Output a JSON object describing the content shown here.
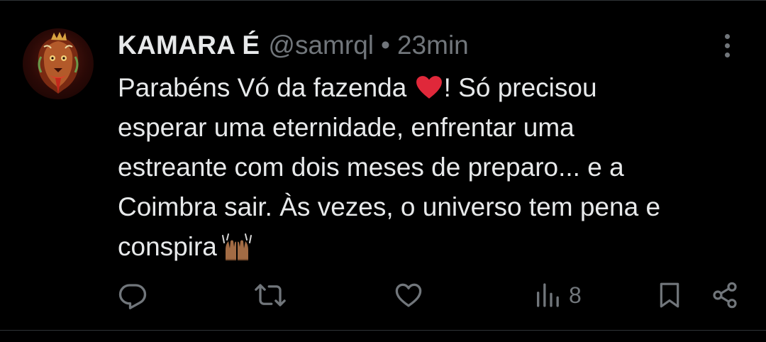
{
  "tweet": {
    "author_name": "KAMARA É",
    "handle": "@samrql",
    "separator": "•",
    "time": "23min",
    "text_lines": [
      "Parabéns Vó da fazenda",
      "! Só precisou",
      "esperar uma eternidade, enfrentar uma",
      "estreante com dois meses de preparo... e a",
      "Coimbra sair. Às vezes, o universo tem pena e",
      "conspira"
    ],
    "emojis": [
      "red-heart",
      "raising-hands"
    ],
    "views_count": "8"
  },
  "actions": {
    "reply_icon": "reply-icon",
    "retweet_icon": "retweet-icon",
    "like_icon": "like-icon",
    "views_icon": "views-icon",
    "bookmark_icon": "bookmark-icon",
    "share_icon": "share-icon"
  },
  "colors": {
    "background": "#000000",
    "text_primary": "#e7e9ea",
    "text_secondary": "#71767b",
    "divider": "#2f3336",
    "heart": "#e0283a"
  }
}
